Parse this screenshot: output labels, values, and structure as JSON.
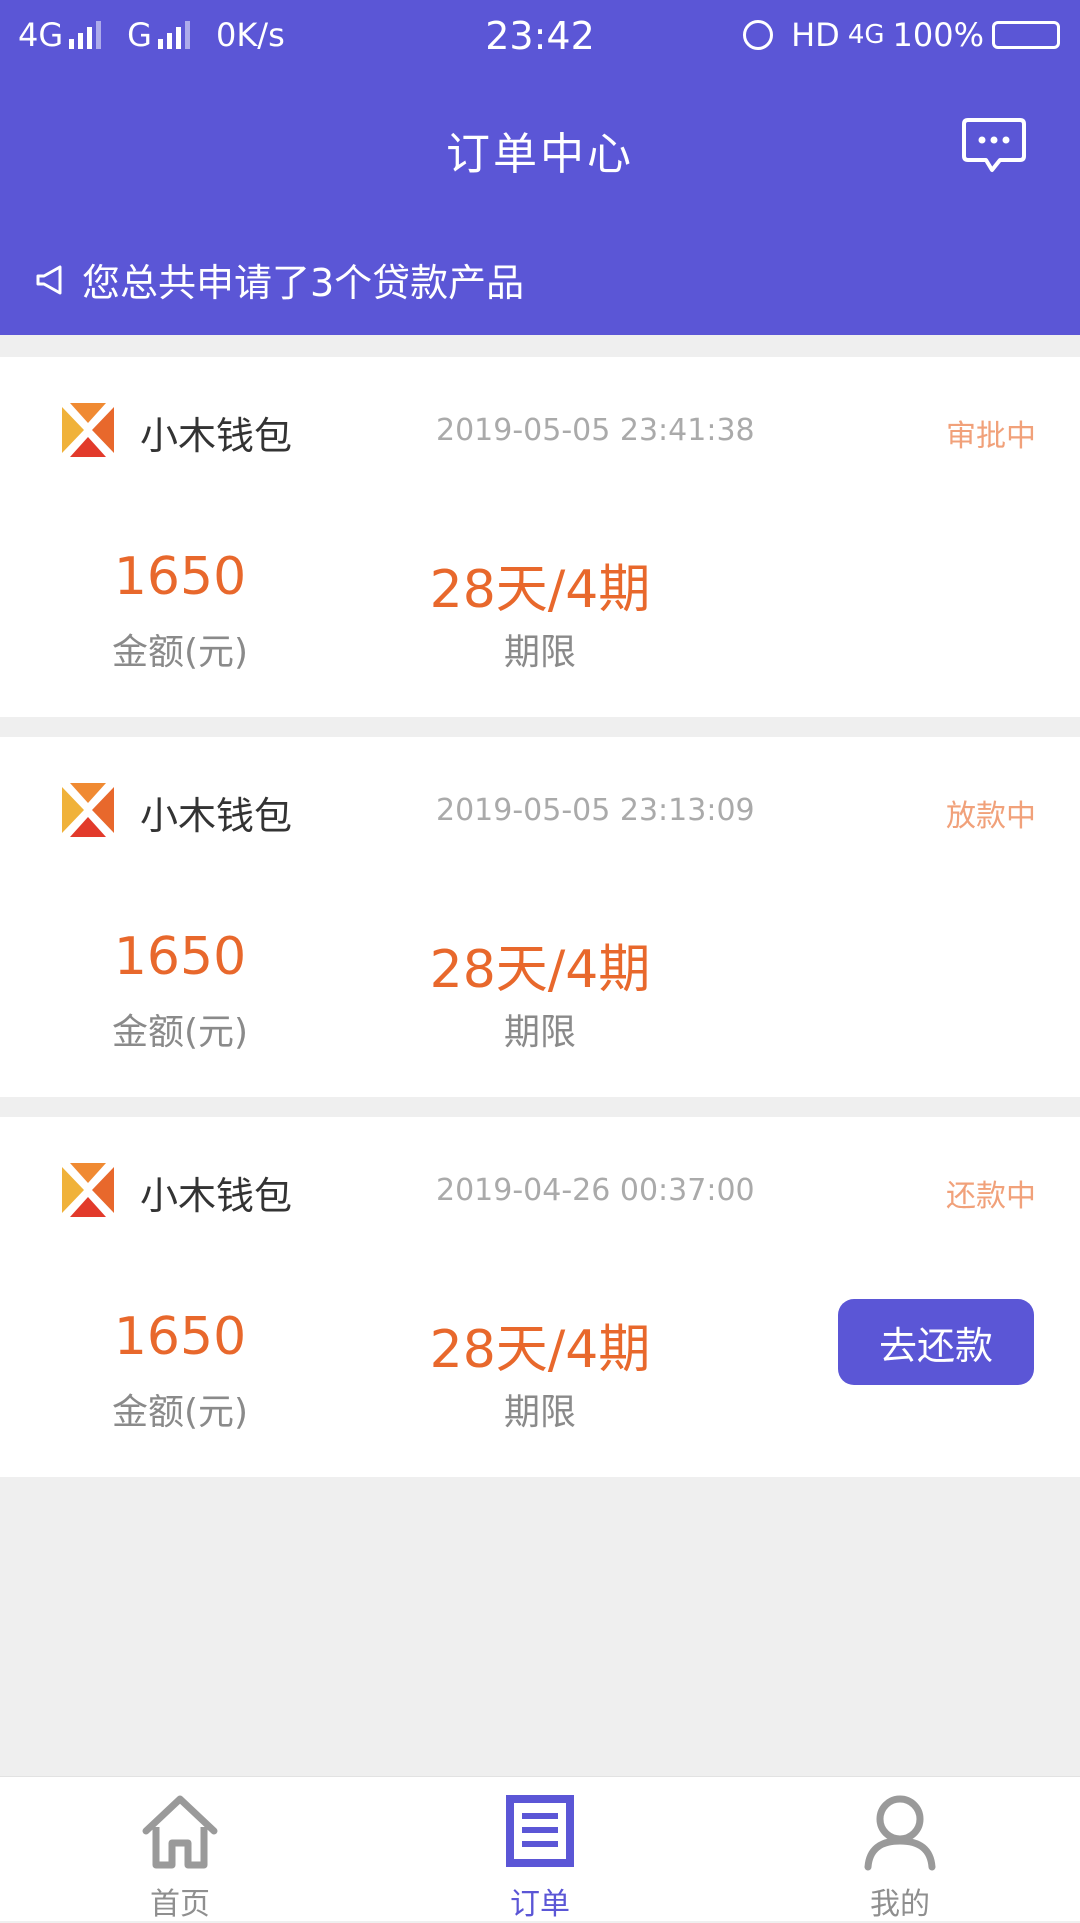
{
  "status_bar": {
    "network1": "4G",
    "network2": "G",
    "speed": "0K/s",
    "time": "23:42",
    "hd": "HD",
    "network3": "4G",
    "battery": "100%"
  },
  "header": {
    "title": "订单中心",
    "message_icon": "chat-bubble-icon",
    "notice_icon": "megaphone-icon",
    "notice": "您总共申请了3个贷款产品"
  },
  "orders": [
    {
      "name": "小木钱包",
      "time": "2019-05-05 23:41:38",
      "status": "审批中",
      "amount": "1650",
      "amount_label": "金额(元)",
      "term": "28天/4期",
      "term_label": "期限"
    },
    {
      "name": "小木钱包",
      "time": "2019-05-05 23:13:09",
      "status": "放款中",
      "amount": "1650",
      "amount_label": "金额(元)",
      "term": "28天/4期",
      "term_label": "期限"
    },
    {
      "name": "小木钱包",
      "time": "2019-04-26 00:37:00",
      "status": "还款中",
      "amount": "1650",
      "amount_label": "金额(元)",
      "term": "28天/4期",
      "term_label": "期限",
      "action": "去还款"
    }
  ],
  "tabbar": {
    "items": [
      {
        "label": "首页",
        "icon": "home-icon"
      },
      {
        "label": "订单",
        "icon": "orders-icon",
        "active": true
      },
      {
        "label": "我的",
        "icon": "user-icon"
      }
    ]
  },
  "colors": {
    "primary": "#5b56d6",
    "amount": "#e8682c",
    "status": "#f1a17a",
    "background": "#efefef"
  }
}
